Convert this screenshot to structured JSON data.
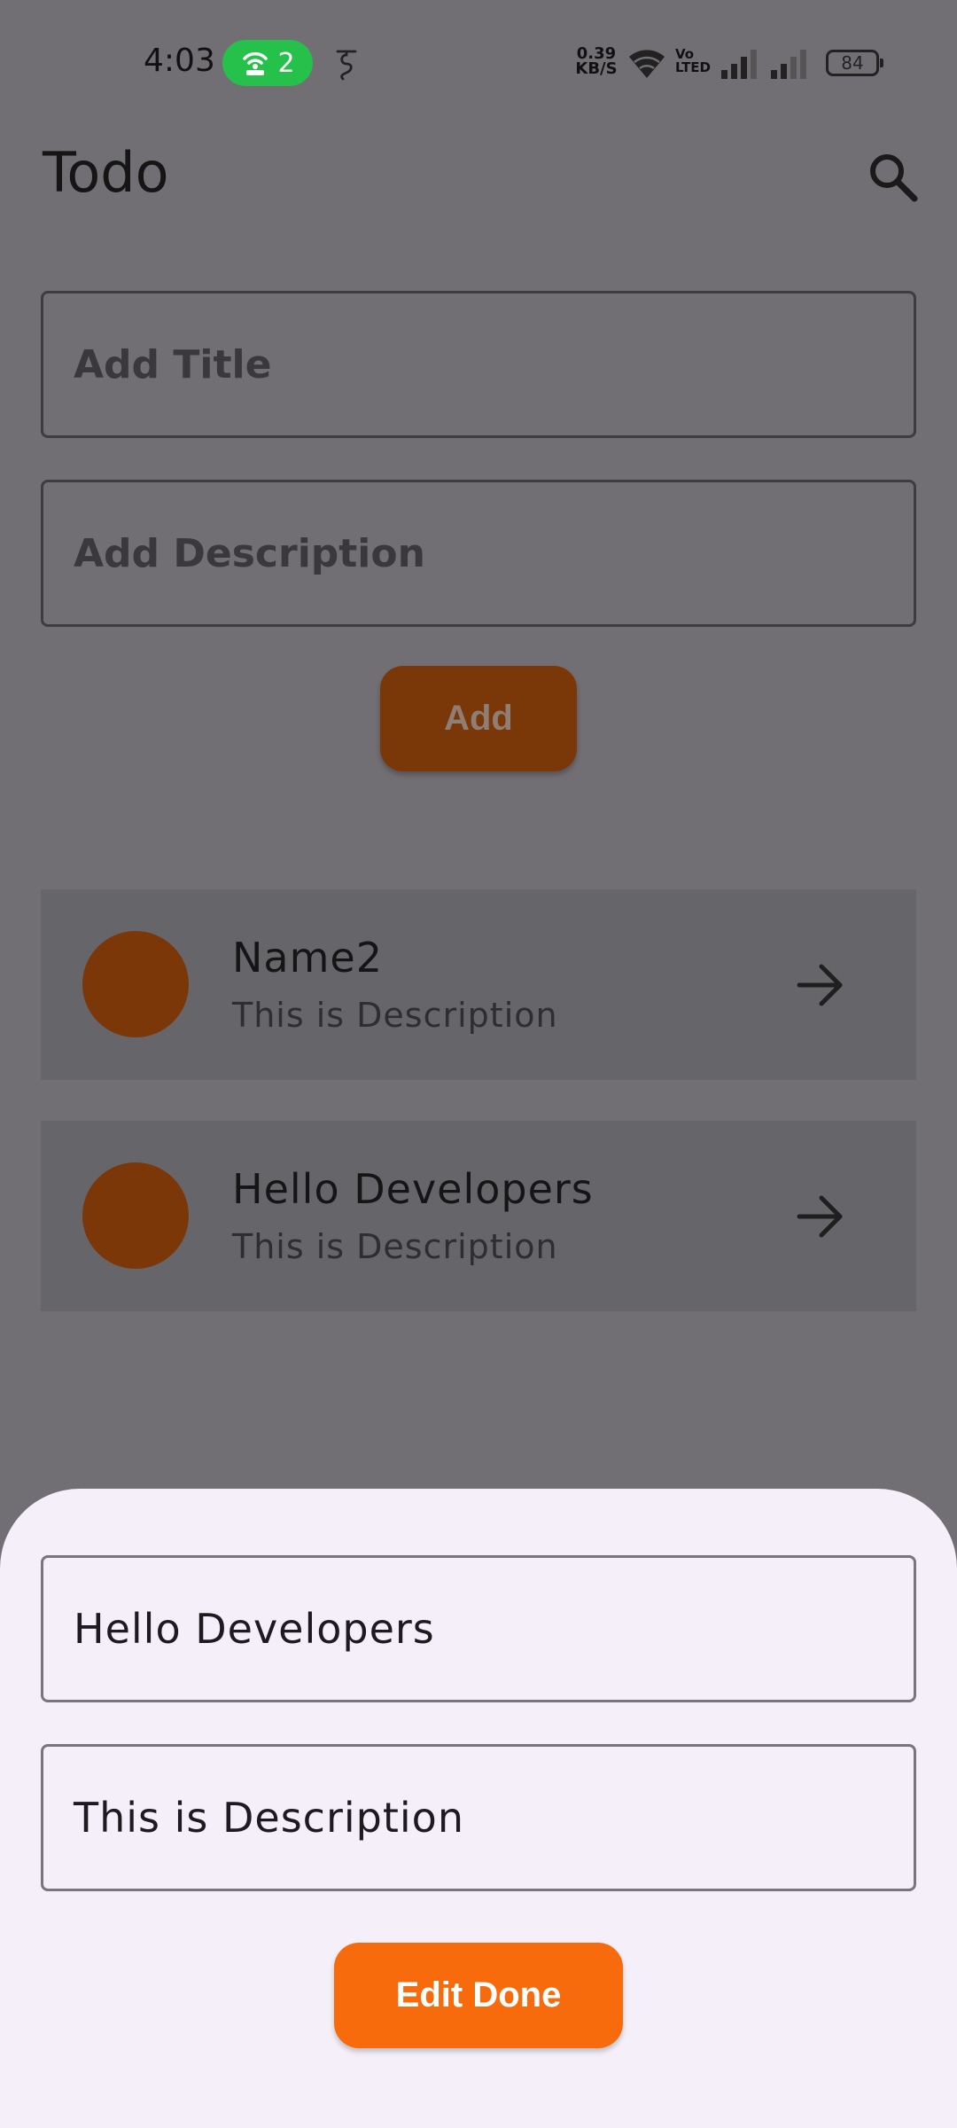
{
  "status_bar": {
    "time": "4:03",
    "hotspot_count": "2",
    "notification_glyph": "ই",
    "net_speed_value": "0.39",
    "net_speed_unit": "KB/S",
    "volte_top": "Vo",
    "volte_bottom": "LTED",
    "battery_level": "84"
  },
  "app_bar": {
    "title": "Todo",
    "search_icon": "search-icon"
  },
  "form": {
    "title_placeholder": "Add Title",
    "description_placeholder": "Add Description",
    "add_label": "Add"
  },
  "todos": [
    {
      "title": "Name2",
      "description": "This is Description"
    },
    {
      "title": "Hello Developers",
      "description": "This is Description"
    }
  ],
  "edit_sheet": {
    "title_value": "Hello Developers",
    "description_value": "This is Description",
    "edit_done_label": "Edit Done"
  },
  "colors": {
    "scrim_background": "#726f74",
    "accent": "#f76b0d",
    "accent_dimmed": "#7a3708",
    "sheet_background": "#f4eff8",
    "hotspot_green": "#25c14a"
  }
}
